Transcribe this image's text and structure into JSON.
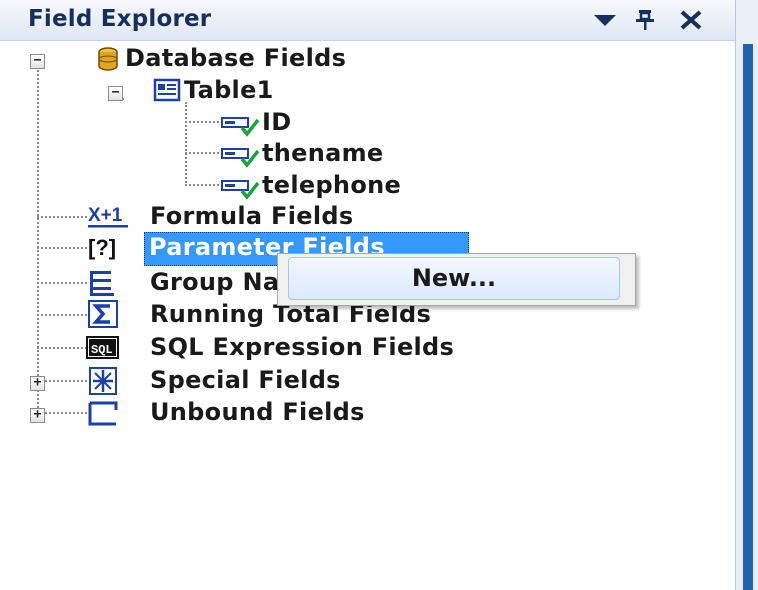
{
  "panel": {
    "title": "Field Explorer",
    "dropdown_glyph": "▾",
    "pin_glyph": "⊥",
    "close_glyph": "✕"
  },
  "tree": {
    "database_fields": "Database Fields",
    "table1": "Table1",
    "fields": [
      "ID",
      "thename",
      "telephone"
    ],
    "formula_fields": "Formula Fields",
    "formula_icon_text": "X+1",
    "parameter_fields": "Parameter Fields",
    "parameter_icon_text": "[?]",
    "group_name_fields": "Group Name Fields",
    "running_total_fields": "Running Total Fields",
    "sql_expression_fields": "SQL Expression Fields",
    "sql_icon_text": "SQL",
    "special_fields": "Special Fields",
    "unbound_fields": "Unbound Fields",
    "expanded_glyph": "−",
    "collapsed_glyph": "+"
  },
  "context_menu": {
    "new_label": "New..."
  },
  "colors": {
    "selection": "#3399ff",
    "title_text": "#15305a"
  }
}
